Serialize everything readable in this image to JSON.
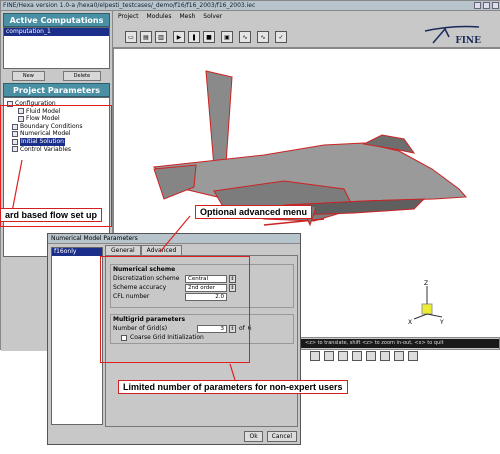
{
  "window": {
    "title": "FINE/Hexa version 1.0-a   /hexa0/elpesti_testcases/_demo/f16/f16_2003/f16_2003.iec"
  },
  "left": {
    "active_title": "Active Computations",
    "active_items": [
      "computation_1"
    ],
    "new_label": "New",
    "delete_label": "Delete",
    "params_title": "Project Parameters",
    "tree": [
      {
        "label": "Configuration",
        "indent": 0,
        "selected": false
      },
      {
        "label": "Fluid Model",
        "indent": 2,
        "selected": false
      },
      {
        "label": "Flow Model",
        "indent": 2,
        "selected": false
      },
      {
        "label": "Boundary Conditions",
        "indent": 1,
        "selected": false
      },
      {
        "label": "Numerical Model",
        "indent": 1,
        "selected": false
      },
      {
        "label": "Initial Solution",
        "indent": 1,
        "selected": true
      },
      {
        "label": "Control Variables",
        "indent": 1,
        "selected": false
      }
    ]
  },
  "menu": [
    "Project",
    "Modules",
    "Mesh",
    "Solver"
  ],
  "logo_text": "FINE",
  "status_text": "<z> to translate, shift <z> to zoom in-out, <x> to quit",
  "dialog": {
    "title": "Numerical Model Parameters",
    "list_item": "f16only",
    "tabs": [
      "General",
      "Advanced"
    ],
    "scheme": {
      "title": "Numerical scheme",
      "disc_label": "Discretization scheme",
      "disc_value": "Central",
      "acc_label": "Scheme accuracy",
      "acc_value": "2nd order",
      "cfl_label": "CFL number",
      "cfl_value": "2.0"
    },
    "multigrid": {
      "title": "Multigrid parameters",
      "grids_label": "Number of Grid(s)",
      "grids_value": "3",
      "of_label": "of",
      "grids_max": "6",
      "coarse_label": "Coarse Grid Initialization"
    },
    "ok": "Ok",
    "cancel": "Cancel"
  },
  "callouts": {
    "flow": "ard based flow set up",
    "advanced": "Optional advanced menu",
    "limited": "Limited number of parameters for non-expert users"
  },
  "axes": {
    "z": "Z",
    "x": "X",
    "y": "Y"
  }
}
